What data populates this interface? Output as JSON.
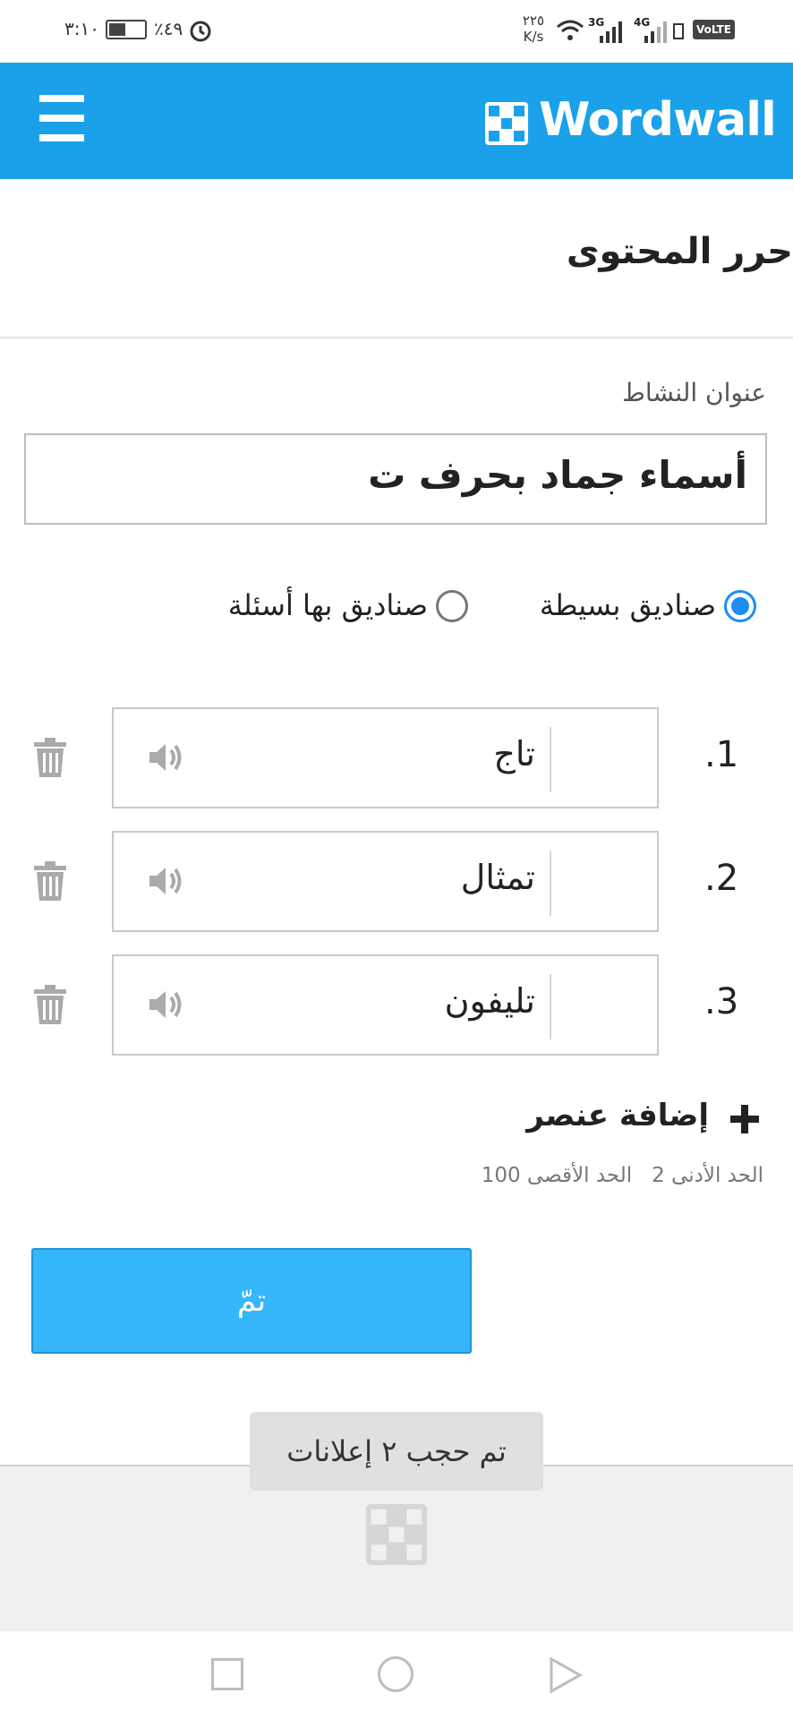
{
  "status_bar": {
    "time": "٣:١٠",
    "battery": "٪٤٩",
    "net_speed_value": "٢٢٥",
    "net_speed_unit": "K/s",
    "signal_1": "3G",
    "signal_2": "4G",
    "volte": "VoLTE"
  },
  "header": {
    "brand": "Wordwall",
    "menu_icon": "hamburger-icon",
    "logo_icon": "wordwall-logo-icon",
    "color": "#1aa1ea"
  },
  "page": {
    "title": "حرر المحتوى"
  },
  "activity": {
    "label": "عنوان النشاط",
    "title_value": "أسماء جماد بحرف ت"
  },
  "box_type": {
    "options": [
      {
        "label": "صناديق بسيطة",
        "selected": true
      },
      {
        "label": "صناديق بها أسئلة",
        "selected": false
      }
    ]
  },
  "items": [
    {
      "number": ".1",
      "text": "تاج"
    },
    {
      "number": ".2",
      "text": "تمثال"
    },
    {
      "number": ".3",
      "text": "تليفون"
    }
  ],
  "add_item": {
    "label": "إضافة عنصر"
  },
  "limits": {
    "min_label": "الحد الأدنى",
    "min_value": "2",
    "max_label": "الحد الأقصى",
    "max_value": "100"
  },
  "done_button": {
    "label": "تمّ",
    "color": "#36b6fb"
  },
  "toast": {
    "text": "تم حجب ٢ إعلانات"
  },
  "accent_color": "#1a8ef5"
}
